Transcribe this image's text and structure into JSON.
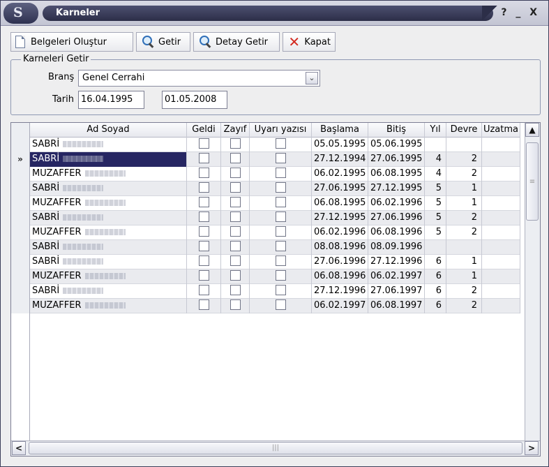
{
  "window": {
    "title": "Karneler",
    "controls": "? _ X",
    "logo": "S"
  },
  "toolbar": {
    "create_docs": "Belgeleri Oluştur",
    "fetch": "Getir",
    "fetch_detail": "Detay Getir",
    "close": "Kapat"
  },
  "filter": {
    "group_title": "Karneleri Getir",
    "branch_label": "Branş",
    "branch_value": "Genel Cerrahi",
    "date_label": "Tarih",
    "date_from": "16.04.1995",
    "date_to": "01.05.2008"
  },
  "grid": {
    "columns": [
      "Ad Soyad",
      "Geldi",
      "Zayıf",
      "Uyarı yazısı",
      "Başlama",
      "Bitiş",
      "Yıl",
      "Devre",
      "Uzatma"
    ],
    "selected_marker": "»",
    "rows": [
      {
        "name": "SABRİ",
        "start": "05.05.1995",
        "end": "05.06.1995",
        "year": "",
        "term": "",
        "alt": false,
        "sel": false
      },
      {
        "name": "SABRİ",
        "start": "27.12.1994",
        "end": "27.06.1995",
        "year": "4",
        "term": "2",
        "alt": true,
        "sel": true
      },
      {
        "name": "MUZAFFER",
        "start": "06.02.1995",
        "end": "06.08.1995",
        "year": "4",
        "term": "2",
        "alt": false,
        "sel": false
      },
      {
        "name": "SABRİ",
        "start": "27.06.1995",
        "end": "27.12.1995",
        "year": "5",
        "term": "1",
        "alt": true,
        "sel": false
      },
      {
        "name": "MUZAFFER",
        "start": "06.08.1995",
        "end": "06.02.1996",
        "year": "5",
        "term": "1",
        "alt": false,
        "sel": false
      },
      {
        "name": "SABRİ",
        "start": "27.12.1995",
        "end": "27.06.1996",
        "year": "5",
        "term": "2",
        "alt": true,
        "sel": false
      },
      {
        "name": "MUZAFFER",
        "start": "06.02.1996",
        "end": "06.08.1996",
        "year": "5",
        "term": "2",
        "alt": false,
        "sel": false
      },
      {
        "name": "SABRİ",
        "start": "08.08.1996",
        "end": "08.09.1996",
        "year": "",
        "term": "",
        "alt": true,
        "sel": false
      },
      {
        "name": "SABRİ",
        "start": "27.06.1996",
        "end": "27.12.1996",
        "year": "6",
        "term": "1",
        "alt": false,
        "sel": false
      },
      {
        "name": "MUZAFFER",
        "start": "06.08.1996",
        "end": "06.02.1997",
        "year": "6",
        "term": "1",
        "alt": true,
        "sel": false
      },
      {
        "name": "SABRİ",
        "start": "27.12.1996",
        "end": "27.06.1997",
        "year": "6",
        "term": "2",
        "alt": false,
        "sel": false
      },
      {
        "name": "MUZAFFER",
        "start": "06.02.1997",
        "end": "06.08.1997",
        "year": "6",
        "term": "2",
        "alt": true,
        "sel": false
      }
    ]
  },
  "scroll": {
    "up": "▲",
    "left": "<",
    "right": ">",
    "grip": "|||"
  }
}
